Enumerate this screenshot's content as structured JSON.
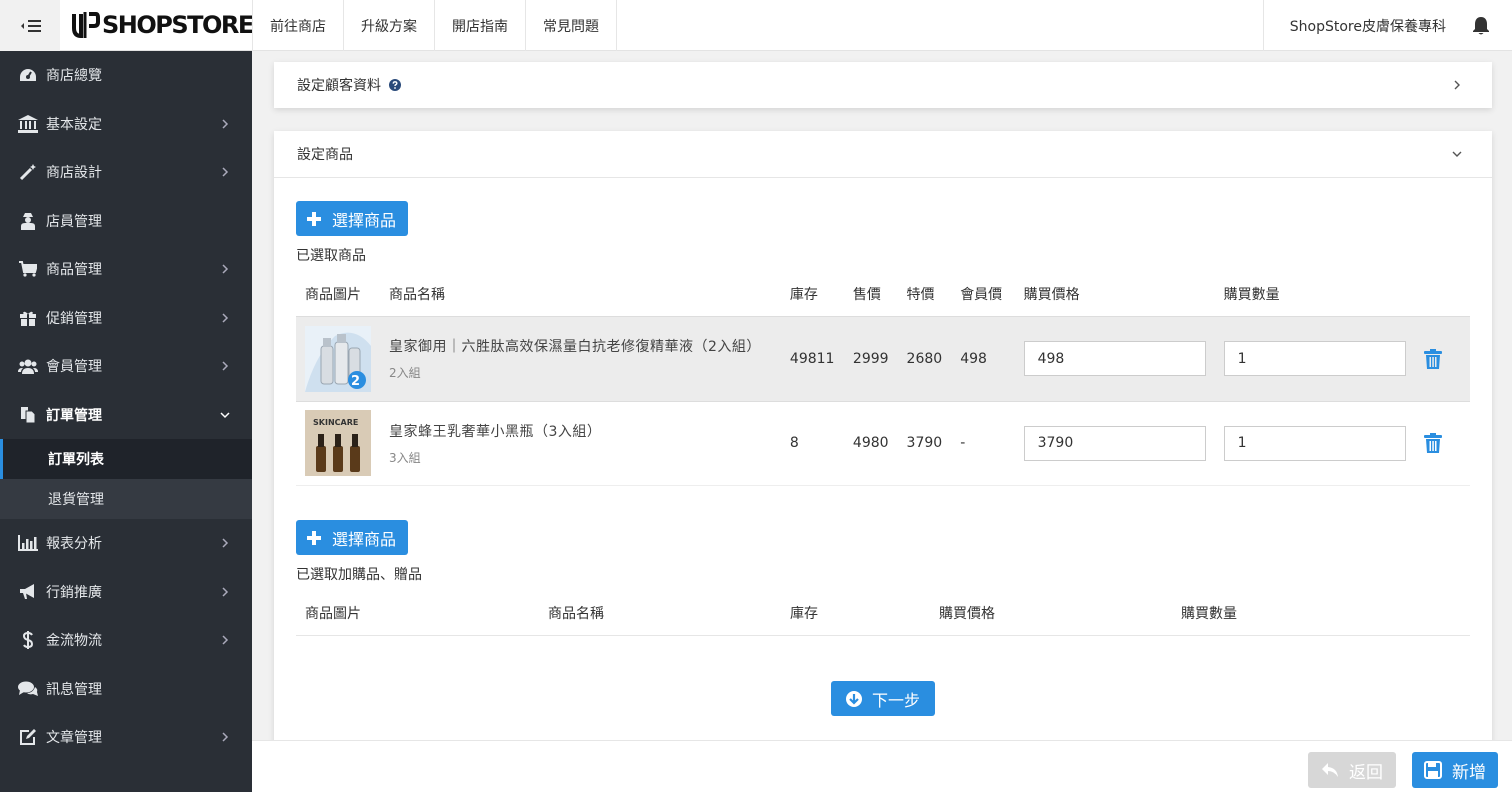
{
  "topbar": {
    "brand": "SHOPSTORE",
    "nav": [
      "前往商店",
      "升級方案",
      "開店指南",
      "常見問題"
    ],
    "store_name": "ShopStore皮膚保養專科"
  },
  "sidebar": {
    "items": [
      {
        "label": "商店總覽",
        "icon": "dashboard-icon",
        "has_chevron": false
      },
      {
        "label": "基本設定",
        "icon": "bank-icon",
        "has_chevron": true
      },
      {
        "label": "商店設計",
        "icon": "magic-wand-icon",
        "has_chevron": true
      },
      {
        "label": "店員管理",
        "icon": "user-secret-icon",
        "has_chevron": false
      },
      {
        "label": "商品管理",
        "icon": "cart-icon",
        "has_chevron": true
      },
      {
        "label": "促銷管理",
        "icon": "gift-icon",
        "has_chevron": true
      },
      {
        "label": "會員管理",
        "icon": "users-icon",
        "has_chevron": true
      },
      {
        "label": "訂單管理",
        "icon": "files-icon",
        "has_chevron": true,
        "expanded": true
      }
    ],
    "sub_items": [
      "訂單列表",
      "退貨管理"
    ],
    "items_after": [
      {
        "label": "報表分析",
        "icon": "bar-chart-icon",
        "has_chevron": true
      },
      {
        "label": "行銷推廣",
        "icon": "bullhorn-icon",
        "has_chevron": true
      },
      {
        "label": "金流物流",
        "icon": "dollar-icon",
        "has_chevron": true
      },
      {
        "label": "訊息管理",
        "icon": "comments-icon",
        "has_chevron": false
      },
      {
        "label": "文章管理",
        "icon": "edit-icon",
        "has_chevron": true
      }
    ]
  },
  "customer_section": {
    "title": "設定顧客資料"
  },
  "product_section": {
    "title": "設定商品",
    "select_button": "選擇商品",
    "selected_label": "已選取商品",
    "columns": [
      "商品圖片",
      "商品名稱",
      "庫存",
      "售價",
      "特價",
      "會員價",
      "購買價格",
      "購買數量"
    ],
    "rows": [
      {
        "name": "皇家御用｜六胜肽高效保濕量白抗老修復精華液（2入組）",
        "variant": "2入組",
        "stock": "49811",
        "price": "2999",
        "special": "2680",
        "member": "498",
        "buy_price": "498",
        "qty": "1",
        "image_badge": "2"
      },
      {
        "name": "皇家蜂王乳奢華小黑瓶（3入組）",
        "variant": "3入組",
        "stock": "8",
        "price": "4980",
        "special": "3790",
        "member": "-",
        "buy_price": "3790",
        "qty": "1",
        "image_label": "SKINCARE"
      }
    ],
    "gift_select_button": "選擇商品",
    "gift_selected_label": "已選取加購品、贈品",
    "gift_columns": [
      "商品圖片",
      "商品名稱",
      "庫存",
      "購買價格",
      "購買數量"
    ],
    "next_button": "下一步"
  },
  "footer": {
    "back_button": "返回",
    "save_button": "新增"
  },
  "colors": {
    "primary": "#2a8ee0",
    "sidebar_bg": "#2a2f36",
    "selected_indicator": "#2a8ee0"
  }
}
